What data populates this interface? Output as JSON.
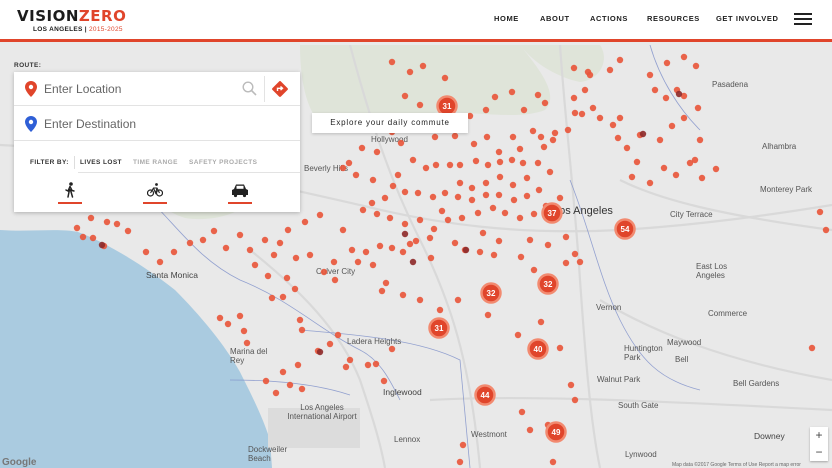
{
  "header": {
    "logo_main_a": "VISION",
    "logo_main_b": "ZERO",
    "logo_city": "LOS ANGELES",
    "logo_years": "2015-2025",
    "nav": [
      "HOME",
      "ABOUT",
      "ACTIONS",
      "RESOURCES",
      "GET INVOLVED"
    ]
  },
  "panel": {
    "route_label": "ROUTE:",
    "location_placeholder": "Enter Location",
    "destination_placeholder": "Enter Destination",
    "filter_by": "FILTER BY:",
    "tabs": [
      "LIVES LOST",
      "TIME RANGE",
      "SAFETY PROJECTS"
    ],
    "active_tab": "LIVES LOST",
    "modes": [
      "pedestrian-icon",
      "bicycle-icon",
      "car-icon"
    ]
  },
  "commute_button": "Explore your daily commute",
  "map": {
    "labels": {
      "hollywood": "Hollywood",
      "beverly_hills": "Beverly Hills",
      "los_angeles": "Los Angeles",
      "santa_monica": "Santa Monica",
      "culver_city": "Culver City",
      "ladera_heights": "Ladera Heights",
      "marina_del_rey": "Marina del Rey",
      "inglewood": "Inglewood",
      "lax": "Los Angeles International Airport",
      "lennox": "Lennox",
      "westmont": "Westmont",
      "dockweiler": "Dockweiler Beach",
      "pasadena": "Pasadena",
      "alhambra": "Alhambra",
      "monterey_park": "Monterey Park",
      "city_terrace": "City Terrace",
      "east_la": "East Los Angeles",
      "commerce": "Commerce",
      "vernon": "Vernon",
      "huntington_park": "Huntington Park",
      "maywood": "Maywood",
      "bell": "Bell",
      "walnut_park": "Walnut Park",
      "bell_gardens": "Bell Gardens",
      "south_gate": "South Gate",
      "lynwood": "Lynwood",
      "downey": "Downey"
    },
    "clusters": [
      31,
      37,
      54,
      32,
      32,
      31,
      40,
      44,
      49
    ],
    "colors": {
      "dot": "#e8573c",
      "dot_dark": "#8e2b2b",
      "cluster": "#e0452b",
      "water": "#aacbe0",
      "land": "#e9e9e9"
    }
  },
  "zoom": {
    "in": "+",
    "out": "−"
  },
  "google": "Google",
  "terms": "Map data ©2017 Google  Terms of Use  Report a map error"
}
